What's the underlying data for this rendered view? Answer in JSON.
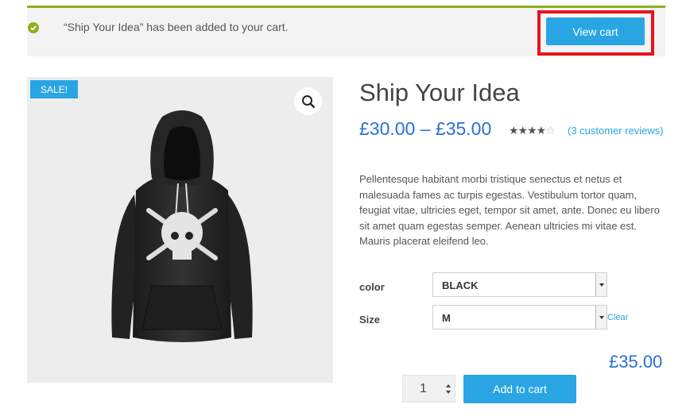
{
  "notice": {
    "message": "“Ship Your Idea” has been added to your cart.",
    "view_cart_label": "View cart",
    "icon": "check-circle-icon",
    "accent_color": "#8fae1b"
  },
  "product": {
    "sale_badge": "SALE!",
    "zoom_icon": "magnifier-icon",
    "title": "Ship Your Idea",
    "price_range": "£30.00 – £35.00",
    "rating": {
      "stars_filled": 4,
      "stars_total": 5,
      "reviews_link": "(3 customer reviews)"
    },
    "description": "Pellentesque habitant morbi tristique senectus et netus et malesuada fames ac turpis egestas. Vestibulum tortor quam, feugiat vitae, ultricies eget, tempor sit amet, ante. Donec eu libero sit amet quam egestas semper. Aenean ultricies mi vitae est. Mauris placerat eleifend leo."
  },
  "variations": {
    "color": {
      "label": "color",
      "selected": "BLACK"
    },
    "size": {
      "label": "Size",
      "selected": "M"
    },
    "clear_label": "Clear",
    "variation_price": "£35.00"
  },
  "cart": {
    "quantity": "1",
    "add_to_cart_label": "Add to cart"
  },
  "colors": {
    "button_blue": "#29a5e3",
    "price_blue": "#2a6fd5",
    "highlight_red": "#e8141b"
  }
}
